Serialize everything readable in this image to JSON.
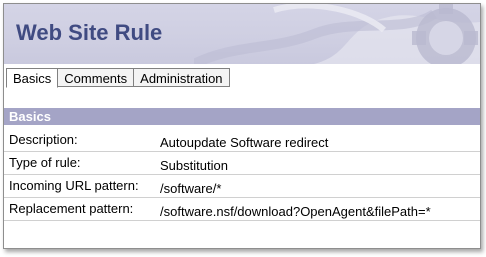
{
  "header": {
    "title": "Web Site Rule"
  },
  "tabs": [
    {
      "label": "Basics",
      "active": true
    },
    {
      "label": "Comments",
      "active": false
    },
    {
      "label": "Administration",
      "active": false
    }
  ],
  "section": {
    "title": "Basics"
  },
  "fields": [
    {
      "label": "Description:",
      "value": "Autoupdate Software redirect"
    },
    {
      "label": "Type of rule:",
      "value": "Substitution"
    },
    {
      "label": "Incoming URL pattern:",
      "value": "/software/*"
    },
    {
      "label": "Replacement pattern:",
      "value": "/software.nsf/download?OpenAgent&filePath=*"
    }
  ],
  "colors": {
    "title": "#404b82",
    "section_header_bg": "#a4a4c6",
    "banner_bg": "#d0d0e3"
  }
}
